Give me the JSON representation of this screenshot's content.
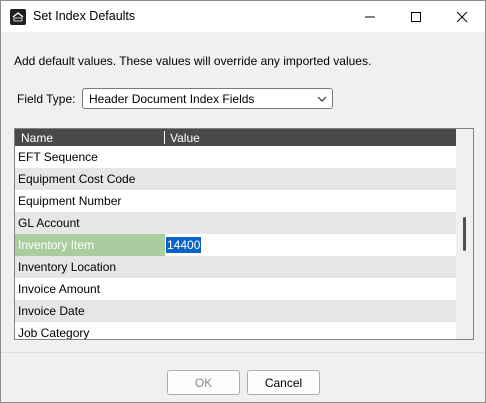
{
  "window": {
    "title": "Set Index Defaults",
    "app_icon": "app-logo-icon"
  },
  "titlebar_buttons": {
    "minimize_icon": "minimize-icon",
    "maximize_icon": "maximize-icon",
    "close_icon": "close-icon"
  },
  "description": "Add default values. These values will override any imported values.",
  "field_type": {
    "label": "Field Type:",
    "selected": "Header Document Index Fields",
    "chevron_icon": "chevron-down-icon"
  },
  "grid": {
    "columns": [
      "Name",
      "Value"
    ],
    "rows": [
      {
        "name": "EFT Sequence",
        "value": ""
      },
      {
        "name": "Equipment Cost Code",
        "value": ""
      },
      {
        "name": "Equipment Number",
        "value": ""
      },
      {
        "name": "GL Account",
        "value": ""
      },
      {
        "name": "Inventory Item",
        "value": "14400",
        "selected": true
      },
      {
        "name": "Inventory Location",
        "value": ""
      },
      {
        "name": "Invoice Amount",
        "value": ""
      },
      {
        "name": "Invoice Date",
        "value": ""
      },
      {
        "name": "Job Category",
        "value": ""
      }
    ],
    "header_color": "#4a4a4a",
    "selected_color": "#a9cda1",
    "text_selection_color": "#0a64c8"
  },
  "buttons": {
    "ok_label": "OK",
    "cancel_label": "Cancel"
  }
}
